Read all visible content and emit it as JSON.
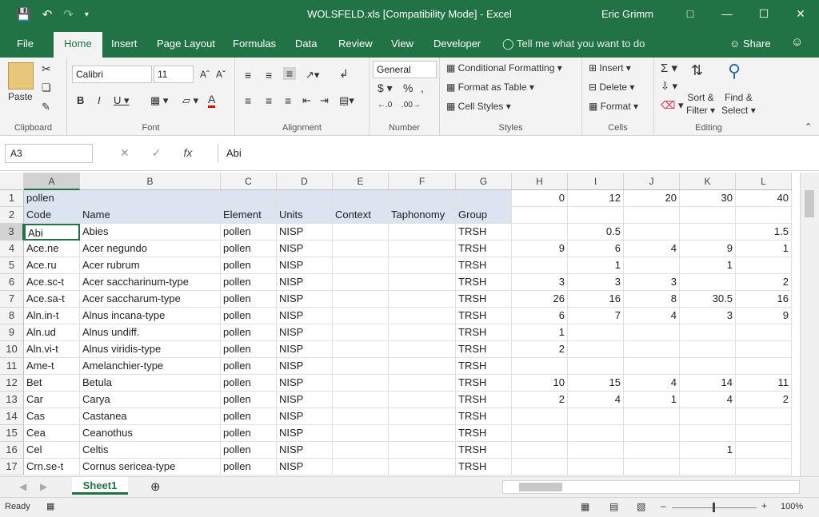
{
  "window": {
    "title": "WOLSFELD.xls  [Compatibility Mode]  -  Excel",
    "user": "Eric Grimm"
  },
  "tabs": [
    "File",
    "Home",
    "Insert",
    "Page Layout",
    "Formulas",
    "Data",
    "Review",
    "View",
    "Developer"
  ],
  "tell_me": "Tell me what you want to do",
  "share": "Share",
  "ribbon": {
    "clipboard": {
      "paste": "Paste",
      "label": "Clipboard"
    },
    "font": {
      "name": "Calibri",
      "size": "11",
      "label": "Font"
    },
    "alignment": {
      "label": "Alignment"
    },
    "number": {
      "format": "General",
      "label": "Number"
    },
    "styles": {
      "conditional": "Conditional Formatting",
      "table": "Format as Table",
      "cell_styles": "Cell Styles",
      "label": "Styles"
    },
    "cells": {
      "insert": "Insert",
      "delete": "Delete",
      "format": "Format",
      "label": "Cells"
    },
    "editing": {
      "sort1": "Sort &",
      "sort2": "Filter",
      "find1": "Find &",
      "find2": "Select",
      "label": "Editing"
    }
  },
  "formula_bar": {
    "name_box": "A3",
    "value": "Abi"
  },
  "columns": [
    "A",
    "B",
    "C",
    "D",
    "E",
    "F",
    "G",
    "H",
    "I",
    "J",
    "K",
    "L"
  ],
  "rows": [
    {
      "n": "1",
      "c": [
        "pollen",
        "",
        "",
        "",
        "",
        "",
        "",
        "0",
        "12",
        "20",
        "30",
        "40"
      ]
    },
    {
      "n": "2",
      "c": [
        "Code",
        "Name",
        "Element",
        "Units",
        "Context",
        "Taphonomy",
        "Group",
        "",
        "",
        "",
        "",
        ""
      ]
    },
    {
      "n": "3",
      "c": [
        "Abi",
        "Abies",
        "pollen",
        "NISP",
        "",
        "",
        "TRSH",
        "",
        "0.5",
        "",
        "",
        "1.5"
      ]
    },
    {
      "n": "4",
      "c": [
        "Ace.ne",
        "Acer negundo",
        "pollen",
        "NISP",
        "",
        "",
        "TRSH",
        "9",
        "6",
        "4",
        "9",
        "1"
      ]
    },
    {
      "n": "5",
      "c": [
        "Ace.ru",
        "Acer rubrum",
        "pollen",
        "NISP",
        "",
        "",
        "TRSH",
        "",
        "1",
        "",
        "1",
        ""
      ]
    },
    {
      "n": "6",
      "c": [
        "Ace.sc-t",
        "Acer saccharinum-type",
        "pollen",
        "NISP",
        "",
        "",
        "TRSH",
        "3",
        "3",
        "3",
        "",
        "2"
      ]
    },
    {
      "n": "7",
      "c": [
        "Ace.sa-t",
        "Acer saccharum-type",
        "pollen",
        "NISP",
        "",
        "",
        "TRSH",
        "26",
        "16",
        "8",
        "30.5",
        "16"
      ]
    },
    {
      "n": "8",
      "c": [
        "Aln.in-t",
        "Alnus incana-type",
        "pollen",
        "NISP",
        "",
        "",
        "TRSH",
        "6",
        "7",
        "4",
        "3",
        "9"
      ]
    },
    {
      "n": "9",
      "c": [
        "Aln.ud",
        "Alnus undiff.",
        "pollen",
        "NISP",
        "",
        "",
        "TRSH",
        "1",
        "",
        "",
        "",
        ""
      ]
    },
    {
      "n": "10",
      "c": [
        "Aln.vi-t",
        "Alnus viridis-type",
        "pollen",
        "NISP",
        "",
        "",
        "TRSH",
        "2",
        "",
        "",
        "",
        ""
      ]
    },
    {
      "n": "11",
      "c": [
        "Ame-t",
        "Amelanchier-type",
        "pollen",
        "NISP",
        "",
        "",
        "TRSH",
        "",
        "",
        "",
        "",
        ""
      ]
    },
    {
      "n": "12",
      "c": [
        "Bet",
        "Betula",
        "pollen",
        "NISP",
        "",
        "",
        "TRSH",
        "10",
        "15",
        "4",
        "14",
        "11"
      ]
    },
    {
      "n": "13",
      "c": [
        "Car",
        "Carya",
        "pollen",
        "NISP",
        "",
        "",
        "TRSH",
        "2",
        "4",
        "1",
        "4",
        "2"
      ]
    },
    {
      "n": "14",
      "c": [
        "Cas",
        "Castanea",
        "pollen",
        "NISP",
        "",
        "",
        "TRSH",
        "",
        "",
        "",
        "",
        ""
      ]
    },
    {
      "n": "15",
      "c": [
        "Cea",
        "Ceanothus",
        "pollen",
        "NISP",
        "",
        "",
        "TRSH",
        "",
        "",
        "",
        "",
        ""
      ]
    },
    {
      "n": "16",
      "c": [
        "Cel",
        "Celtis",
        "pollen",
        "NISP",
        "",
        "",
        "TRSH",
        "",
        "",
        "",
        "1",
        ""
      ]
    },
    {
      "n": "17",
      "c": [
        "Crn.se-t",
        "Cornus sericea-type",
        "pollen",
        "NISP",
        "",
        "",
        "TRSH",
        "",
        "",
        "",
        "",
        ""
      ]
    }
  ],
  "sheet_tab": "Sheet1",
  "status": {
    "ready": "Ready",
    "zoom": "100%"
  }
}
